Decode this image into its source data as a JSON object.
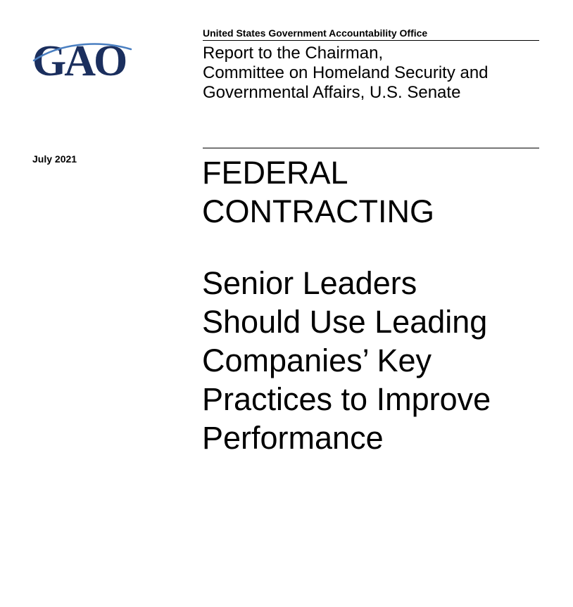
{
  "header": {
    "agency": "United States Government Accountability Office",
    "logo_text": "GAO",
    "recipient_lines": [
      "Report to the Chairman,",
      "Committee on Homeland Security and",
      "Governmental Affairs, U.S. Senate"
    ]
  },
  "report": {
    "date": "July 2021",
    "title_lines": [
      "FEDERAL",
      "CONTRACTING"
    ],
    "subtitle_lines": [
      "Senior Leaders",
      "Should Use Leading",
      "Companies’ Key",
      "Practices to Improve",
      "Performance"
    ]
  },
  "colors": {
    "logo_navy": "#1b2f5e",
    "logo_swoosh": "#4a7fc1",
    "text": "#000000",
    "background": "#ffffff"
  },
  "icons": {
    "logo": "gao-logo-icon"
  }
}
